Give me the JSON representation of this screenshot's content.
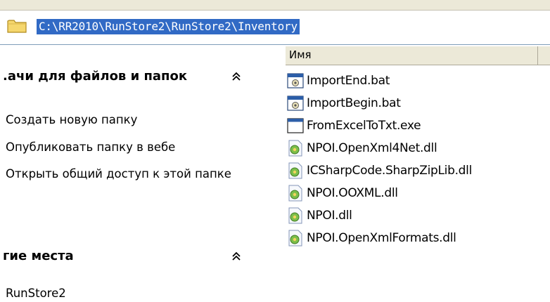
{
  "address": {
    "path": "C:\\RR2010\\RunStore2\\RunStore2\\Inventory"
  },
  "tasks_panel": {
    "file_tasks": {
      "title": ".ачи для файлов и папок",
      "collapse_icon": "chevron-double-up",
      "items": [
        {
          "label": "Создать новую папку"
        },
        {
          "label": "Опубликовать папку в вебе"
        },
        {
          "label": "Открыть общий доступ к этой папке"
        }
      ]
    },
    "other_places": {
      "title": "гие места",
      "collapse_icon": "chevron-double-up",
      "items": [
        {
          "label": "RunStore2"
        }
      ]
    }
  },
  "file_list": {
    "column_name": "Имя",
    "files": [
      {
        "name": "ImportEnd.bat",
        "icon": "batch-file-icon"
      },
      {
        "name": "ImportBegin.bat",
        "icon": "batch-file-icon"
      },
      {
        "name": "FromExcelToTxt.exe",
        "icon": "exe-window-icon"
      },
      {
        "name": "NPOI.OpenXml4Net.dll",
        "icon": "dll-file-icon"
      },
      {
        "name": "ICSharpCode.SharpZipLib.dll",
        "icon": "dll-file-icon"
      },
      {
        "name": "NPOI.OOXML.dll",
        "icon": "dll-file-icon"
      },
      {
        "name": "NPOI.dll",
        "icon": "dll-file-icon"
      },
      {
        "name": "NPOI.OpenXmlFormats.dll",
        "icon": "dll-file-icon"
      }
    ]
  },
  "colors": {
    "selection": "#316ac5",
    "header_bg": "#ece9d8",
    "folder_yellow": "#f5d76e"
  }
}
